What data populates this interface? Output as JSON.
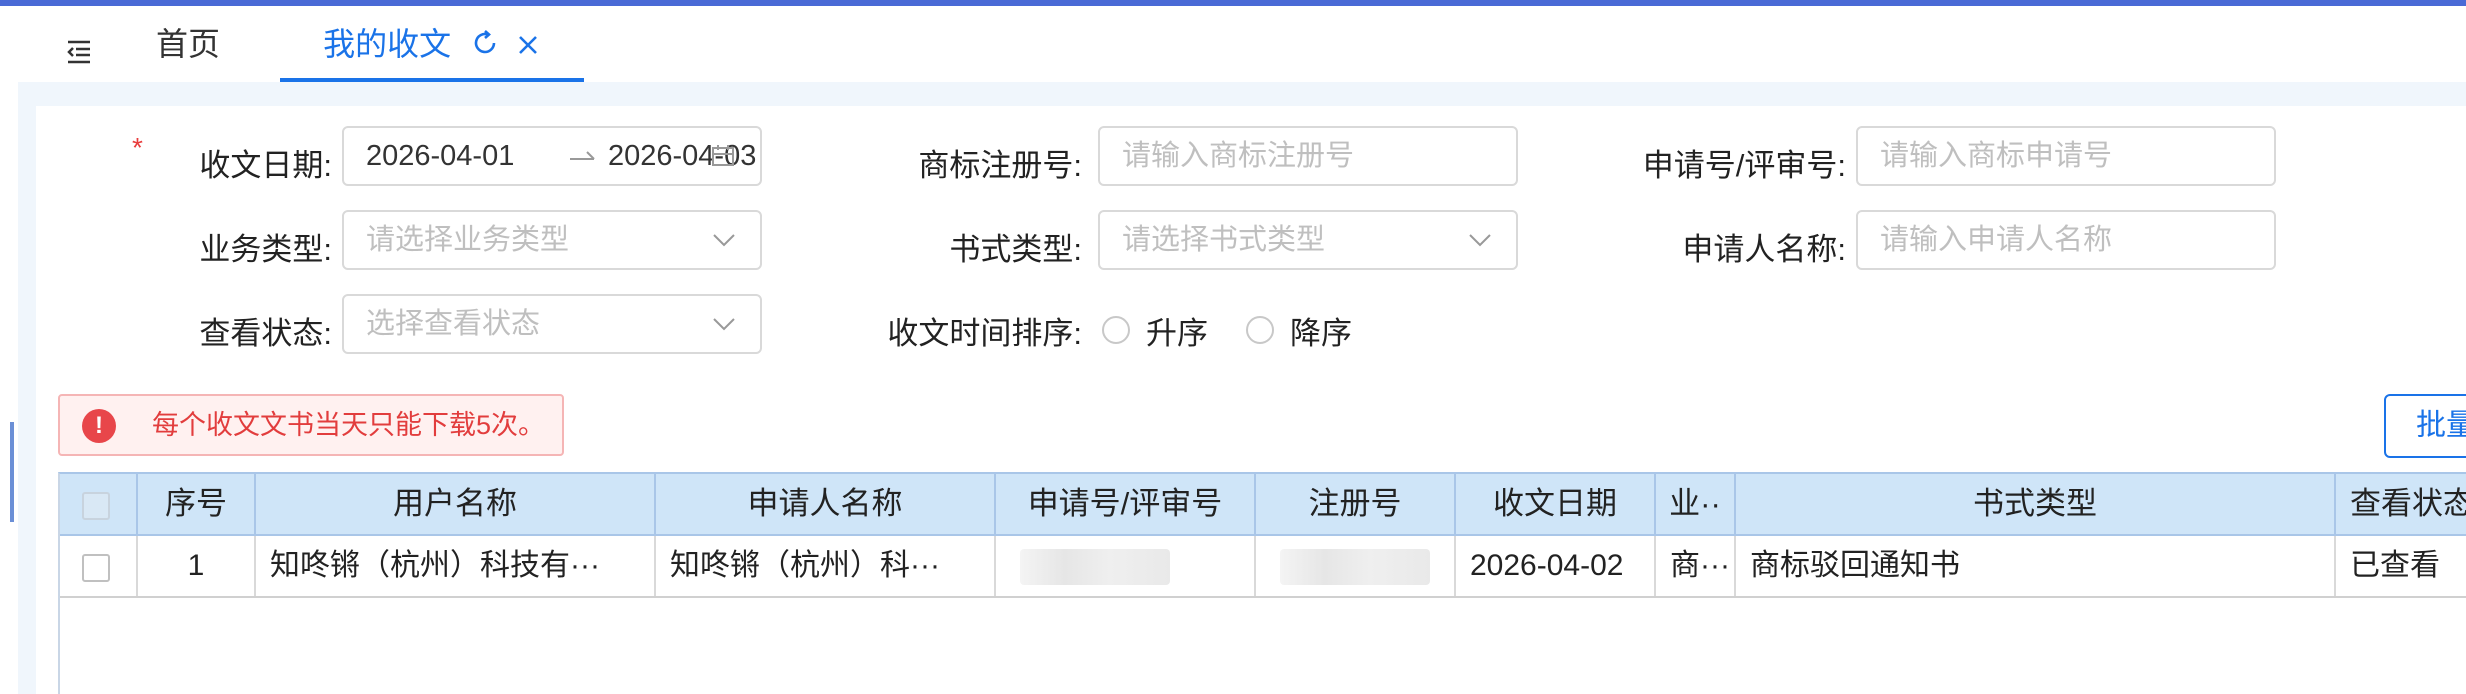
{
  "tabs": {
    "home": "首页",
    "active": "我的收文"
  },
  "filters": {
    "date_label": "收文日期:",
    "date_start": "2026-04-01",
    "date_end": "2026-04-03",
    "reg_label": "商标注册号:",
    "reg_placeholder": "请输入商标注册号",
    "appno_label": "申请号/评审号:",
    "appno_placeholder": "请输入商标申请号",
    "biz_label": "业务类型:",
    "biz_placeholder": "请选择业务类型",
    "doc_label": "书式类型:",
    "doc_placeholder": "请选择书式类型",
    "applicant_label": "申请人名称:",
    "applicant_placeholder": "请输入申请人名称",
    "view_label": "查看状态:",
    "view_placeholder": "选择查看状态",
    "sort_label": "收文时间排序:",
    "sort_asc": "升序",
    "sort_desc": "降序"
  },
  "alert": {
    "text": "每个收文文书当天只能下载5次。"
  },
  "batch_button": "批量",
  "table": {
    "headers": [
      "序号",
      "用户名称",
      "申请人名称",
      "申请号/评审号",
      "注册号",
      "收文日期",
      "业··",
      "书式类型",
      "查看状态"
    ],
    "rows": [
      {
        "index": "1",
        "user": "知咚锵（杭州）科技有···",
        "applicant": "知咚锵（杭州）科···",
        "date": "2026-04-02",
        "biz": "商···",
        "doc_type": "商标驳回通知书",
        "view_status": "已查看"
      }
    ]
  },
  "colors": {
    "accent": "#1a73e8",
    "header_bg": "#cfe5f8",
    "alert_red": "#e23d3d"
  }
}
